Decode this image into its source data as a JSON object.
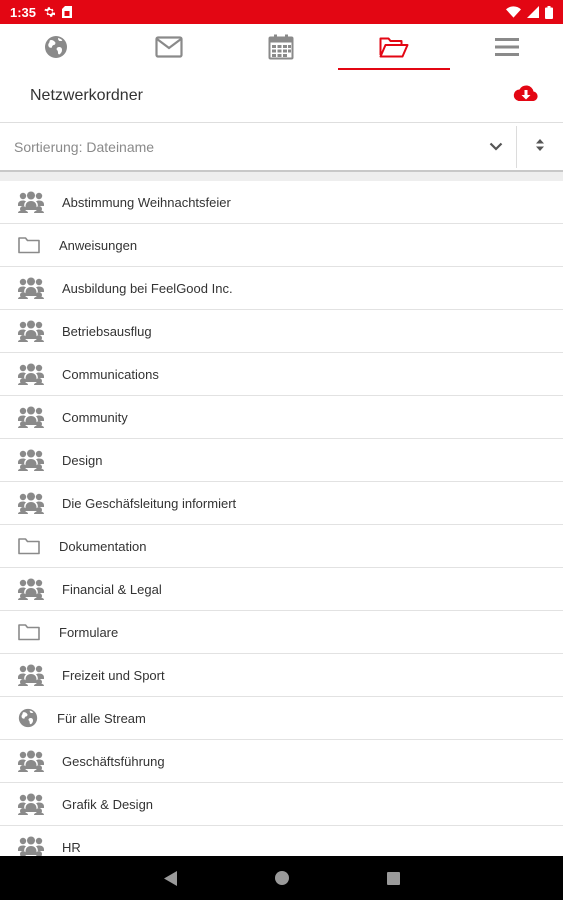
{
  "status_bar": {
    "time": "1:35",
    "left_icons": [
      "settings-icon",
      "sim-card-icon"
    ],
    "right_icons": [
      "wifi-icon",
      "signal-icon",
      "battery-icon"
    ],
    "background": "#e30613"
  },
  "tabs": [
    {
      "icon": "globe-icon",
      "active": false
    },
    {
      "icon": "envelope-icon",
      "active": false
    },
    {
      "icon": "calendar-icon",
      "active": false
    },
    {
      "icon": "folder-open-icon",
      "active": true
    },
    {
      "icon": "menu-icon",
      "active": false
    }
  ],
  "header": {
    "title": "Netzwerkordner",
    "action_icon": "cloud-download-icon"
  },
  "sort": {
    "label": "Sortierung: Dateiname",
    "dropdown_icon": "chevron-down-icon",
    "order_icon": "sort-icon"
  },
  "items": [
    {
      "label": "Abstimmung Weihnachtsfeier",
      "icon": "group-icon"
    },
    {
      "label": "Anweisungen",
      "icon": "folder-icon"
    },
    {
      "label": "Ausbildung bei FeelGood Inc.",
      "icon": "group-icon"
    },
    {
      "label": "Betriebsausflug",
      "icon": "group-icon"
    },
    {
      "label": "Communications",
      "icon": "group-icon"
    },
    {
      "label": "Community",
      "icon": "group-icon"
    },
    {
      "label": "Design",
      "icon": "group-icon"
    },
    {
      "label": "Die Geschäfsleitung informiert",
      "icon": "group-icon"
    },
    {
      "label": "Dokumentation",
      "icon": "folder-icon"
    },
    {
      "label": "Financial & Legal",
      "icon": "group-icon"
    },
    {
      "label": "Formulare",
      "icon": "folder-icon"
    },
    {
      "label": "Freizeit und Sport",
      "icon": "group-icon"
    },
    {
      "label": "Für alle Stream",
      "icon": "globe-icon"
    },
    {
      "label": "Geschäftsführung",
      "icon": "group-icon"
    },
    {
      "label": "Grafik & Design",
      "icon": "group-icon"
    },
    {
      "label": "HR",
      "icon": "group-icon"
    }
  ],
  "nav_bar": {
    "buttons": [
      "back-icon",
      "home-icon",
      "recents-icon"
    ]
  },
  "colors": {
    "accent": "#e30613",
    "icon_gray": "#888888"
  }
}
